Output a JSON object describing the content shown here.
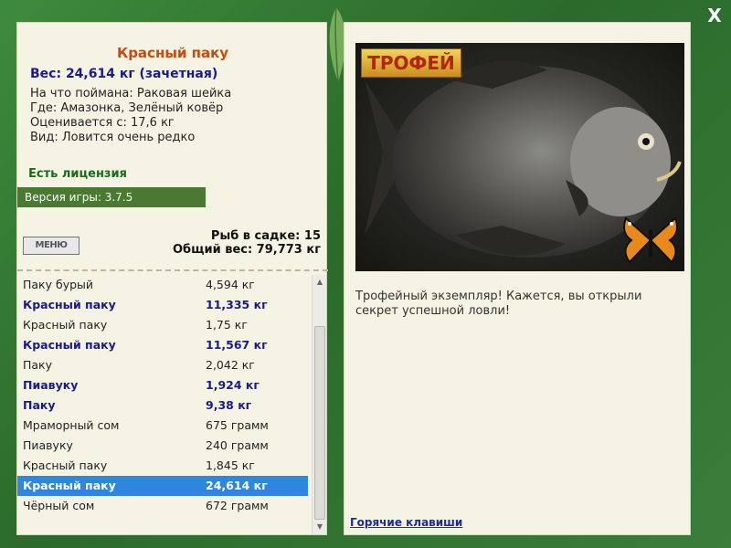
{
  "window": {
    "close_label": "X"
  },
  "fish": {
    "title": "Красный паку",
    "weight": "Вес: 24,614 кг (зачетная)",
    "bait": "На что поймана: Раковая шейка",
    "location": "Где: Амазонка, Зелёный ковёр",
    "value": "Оценивается с: 17,6 кг",
    "rarity": "Вид: Ловится очень редко"
  },
  "license": "Есть лицензия",
  "version": "Версия игры: 3.7.5",
  "menu_label": "МЕНЮ",
  "stats": {
    "count": "Рыб в садке: 15",
    "total": "Общий вес: 79,773 кг"
  },
  "catch_list": [
    {
      "name": "Паку бурый",
      "weight": "4,594 кг",
      "style": "normal"
    },
    {
      "name": "Красный паку",
      "weight": "11,335 кг",
      "style": "bold"
    },
    {
      "name": "Красный паку",
      "weight": "1,75 кг",
      "style": "normal"
    },
    {
      "name": "Красный паку",
      "weight": "11,567 кг",
      "style": "bold"
    },
    {
      "name": "Паку",
      "weight": "2,042 кг",
      "style": "normal"
    },
    {
      "name": "Пиавуку",
      "weight": "1,924 кг",
      "style": "bold"
    },
    {
      "name": "Паку",
      "weight": "9,38 кг",
      "style": "bold"
    },
    {
      "name": "Мраморный сом",
      "weight": "675 грамм",
      "style": "normal"
    },
    {
      "name": "Пиавуку",
      "weight": "240 грамм",
      "style": "normal"
    },
    {
      "name": "Красный паку",
      "weight": "1,845 кг",
      "style": "normal"
    },
    {
      "name": "Красный паку",
      "weight": "24,614 кг",
      "style": "selected"
    },
    {
      "name": "Чёрный сом",
      "weight": "672 грамм",
      "style": "normal"
    }
  ],
  "trophy_badge": "ТРОФЕЙ",
  "caption": "Трофейный экземпляр! Кажется, вы открыли секрет успешной ловли!",
  "hotkeys_label": "Горячие клавиши",
  "icons": [
    "close-icon",
    "scroll-up-icon",
    "scroll-down-icon",
    "butterfly-icon",
    "leaf-decoration"
  ]
}
